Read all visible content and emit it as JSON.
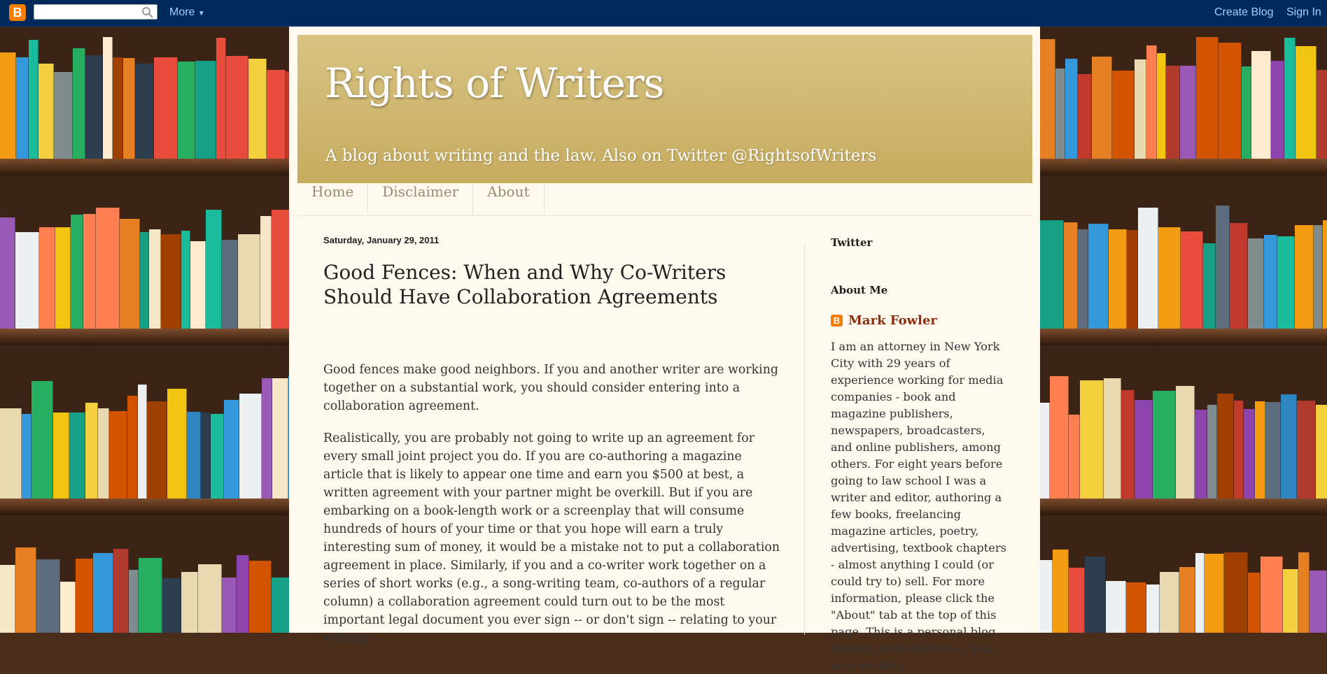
{
  "navbar": {
    "logo_letter": "B",
    "search_placeholder": "",
    "more_label": "More",
    "create_blog_label": "Create Blog",
    "sign_in_label": "Sign In"
  },
  "header": {
    "title": "Rights of Writers",
    "description": "A blog about writing and the law. Also on Twitter @RightsofWriters"
  },
  "tabs": [
    {
      "label": "Home"
    },
    {
      "label": "Disclaimer"
    },
    {
      "label": "About"
    }
  ],
  "post": {
    "date": "Saturday, January 29, 2011",
    "title": "Good Fences: When and Why Co-Writers Should Have Collaboration Agreements",
    "paragraphs": [
      "Good fences make good neighbors.  If you and another writer are working together on a substantial work, you should consider entering into a collaboration agreement.",
      "Realistically, you are probably not going to write up an agreement for every small joint project you do.  If you are co-authoring a magazine article that is likely to appear one time and earn you $500 at best, a written agreement with your partner might be overkill.  But if you are embarking on a book-length work or a screenplay that will consume hundreds of hours of your time or that you hope will earn a truly interesting sum of money, it would be a mistake not to put a collaboration agreement in place.  Similarly, if you and a co-writer work together on a series of short works (e.g., a song-writing team, co-authors of a regular column) a collaboration agreement could turn out to be the most important legal document you ever sign -- or don't sign -- relating to your writing."
    ]
  },
  "sidebar": {
    "twitter_title": "Twitter",
    "about_title": "About Me",
    "profile_name": "Mark Fowler",
    "profile_text": "I am an attorney in New York City with 29 years of experience working for media companies - book and magazine publishers, newspapers, broadcasters, and online publishers, among others. For eight years before going to law school I was a writer and editor, authoring a few books, freelancing magazine articles, poetry, advertising, textbook chapters - almost anything I could (or could try to) sell. For more information, please click the \"About\" tab at the top of this page. This is a personal blog dealing with questions I had as a working"
  },
  "colors": {
    "navbar_bg": "#002a5c",
    "header_gold": "#c6ac5f",
    "page_bg": "#fff9ee",
    "link_brown": "#8a2e0f",
    "blogger_orange": "#f57d00"
  }
}
